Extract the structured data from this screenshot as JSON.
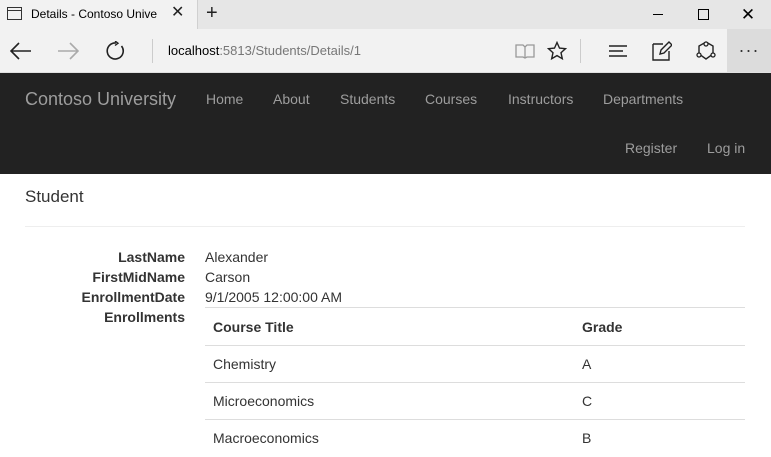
{
  "browser": {
    "tab_title": "Details - Contoso Unive",
    "url_host": "localhost",
    "url_path": ":5813/Students/Details/1"
  },
  "navbar": {
    "brand": "Contoso University",
    "links": [
      "Home",
      "About",
      "Students",
      "Courses",
      "Instructors",
      "Departments"
    ],
    "register": "Register",
    "login": "Log in"
  },
  "page": {
    "heading": "Student",
    "fields": [
      {
        "label": "LastName",
        "value": "Alexander"
      },
      {
        "label": "FirstMidName",
        "value": "Carson"
      },
      {
        "label": "EnrollmentDate",
        "value": "9/1/2005 12:00:00 AM"
      }
    ],
    "enrollments_label": "Enrollments",
    "enrollments": {
      "headers": [
        "Course Title",
        "Grade"
      ],
      "rows": [
        [
          "Chemistry",
          "A"
        ],
        [
          "Microeconomics",
          "C"
        ],
        [
          "Macroeconomics",
          "B"
        ]
      ]
    }
  }
}
